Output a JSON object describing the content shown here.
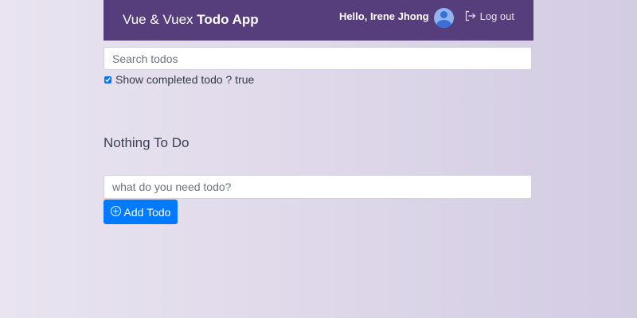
{
  "header": {
    "brand_prefix": "Vue & Vuex ",
    "brand_strong": "Todo App",
    "greeting": "Hello, Irene Jhong",
    "avatar_icon": "user-avatar-icon",
    "logout_label": "Log out",
    "logout_icon": "log-out-icon",
    "bg_color": "#563d7c"
  },
  "search": {
    "placeholder": "Search todos",
    "value": ""
  },
  "filter": {
    "checked": true,
    "label": "Show completed todo ? true"
  },
  "todos": {
    "empty_message": "Nothing To Do",
    "items": []
  },
  "new_todo": {
    "placeholder": "what do you need todo?",
    "value": "",
    "add_label": "Add Todo",
    "add_icon": "plus-circle-icon",
    "button_color": "#007bff"
  }
}
